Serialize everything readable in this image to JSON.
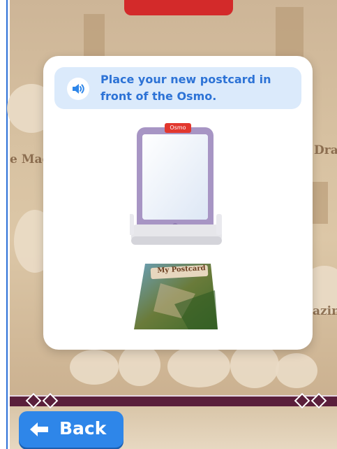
{
  "background": {
    "left_word": "e Mag",
    "right_word_top": "Drag",
    "right_word_bottom": "azin"
  },
  "dialog": {
    "prompt_line_1": "Place your new postcard in",
    "prompt_line_2": "front of the Osmo.",
    "speaker_icon": "speaker-icon",
    "tablet_tag": "Osmo",
    "postcard_label": "My Postcard"
  },
  "back_button": {
    "label": "Back",
    "icon": "arrow-left-icon"
  },
  "colors": {
    "accent_blue": "#2e86e9",
    "prompt_bg": "#dbeafb",
    "prompt_text": "#2d73d6",
    "osmo_red": "#e2372e",
    "ribbon": "#5a1f3b"
  }
}
